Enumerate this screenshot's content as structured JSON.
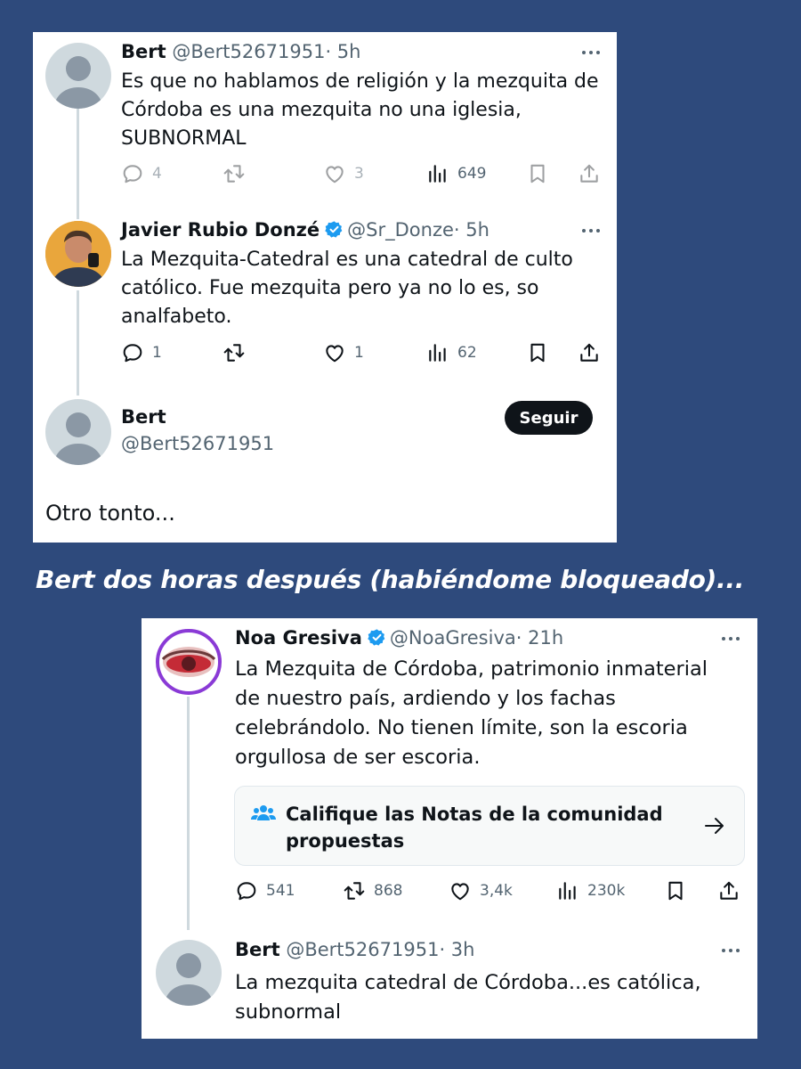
{
  "card1": {
    "tweet1": {
      "name": "Bert",
      "handle": "@Bert52671951",
      "time": "· 5h",
      "lines": [
        "Es que no hablamos de religión y la mezquita de",
        "Córdoba es una mezquita no una iglesia,",
        "SUBNORMAL"
      ],
      "replies": "4",
      "likes": "3",
      "views": "649"
    },
    "tweet2": {
      "name": "Javier Rubio Donzé",
      "handle": "@Sr_Donze",
      "time": "· 5h",
      "lines": [
        "La Mezquita-Catedral es una catedral de culto",
        "católico. Fue mezquita pero ya no lo es, so",
        "analfabeto."
      ],
      "replies": "1",
      "likes": "1",
      "views": "62"
    },
    "profile": {
      "name": "Bert",
      "handle": "@Bert52671951",
      "follow_label": "Seguir",
      "text": "Otro tonto..."
    }
  },
  "caption": "Bert dos horas después (habiéndome bloqueado)...",
  "card2": {
    "tweet1": {
      "name": "Noa Gresiva",
      "handle": "@NoaGresiva",
      "time": "· 21h",
      "lines": [
        "La Mezquita de Córdoba, patrimonio inmaterial",
        "de nuestro país, ardiendo y los fachas",
        "celebrándolo. No tienen límite, son la escoria",
        "orgullosa de ser escoria."
      ],
      "notes_lines": [
        "Califique las Notas de la comunidad",
        "propuestas"
      ],
      "replies": "541",
      "retweets": "868",
      "likes": "3,4k",
      "views": "230k"
    },
    "tweet2": {
      "name": "Bert",
      "handle": "@Bert52671951",
      "time": "· 3h",
      "lines": [
        "La mezquita catedral de Córdoba...es católica,",
        "subnormal"
      ]
    }
  },
  "colors": {
    "background": "#2e4a7c",
    "verified": "#1d9bf0",
    "text_secondary": "#536471",
    "avatar_default": "#cfd9de"
  },
  "icons": [
    "reply-icon",
    "retweet-icon",
    "like-icon",
    "views-icon",
    "bookmark-icon",
    "share-icon",
    "verified-badge-icon",
    "more-icon",
    "community-notes-icon",
    "arrow-right-icon"
  ]
}
